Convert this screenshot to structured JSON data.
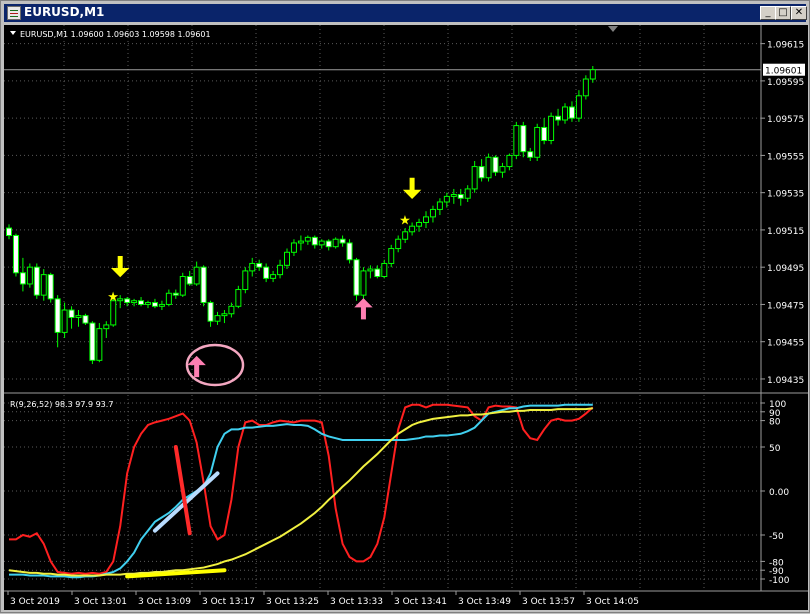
{
  "window": {
    "title": "EURUSD,M1",
    "minimize_label": "_",
    "restore_label": "□",
    "close_label": "✕"
  },
  "chart_data": [
    {
      "type": "candlestick",
      "title": "EURUSD,M1  1.09600 1.09603 1.09598 1.09601",
      "current_price_label": "1.09601",
      "current_price": 1.09601,
      "y_ticks": [
        1.09615,
        1.09595,
        1.09575,
        1.09555,
        1.09535,
        1.09515,
        1.09495,
        1.09475,
        1.09455,
        1.09435
      ],
      "y_tick_labels": [
        "1.09615",
        "1.09595",
        "1.09575",
        "1.09555",
        "1.09535",
        "1.09515",
        "1.09495",
        "1.09475",
        "1.09455",
        "1.09435"
      ],
      "ylim": [
        1.09428,
        1.09625
      ],
      "candle_up_color": "#00ff00",
      "candle_down_color": "#ffffff",
      "grid": true,
      "ohlc": [
        [
          1.09516,
          1.09518,
          1.0951,
          1.09512
        ],
        [
          1.09512,
          1.09513,
          1.0949,
          1.09492
        ],
        [
          1.09492,
          1.095,
          1.09482,
          1.09486
        ],
        [
          1.09486,
          1.09497,
          1.09484,
          1.09495
        ],
        [
          1.09495,
          1.09497,
          1.09478,
          1.0948
        ],
        [
          1.0948,
          1.09494,
          1.09477,
          1.09491
        ],
        [
          1.09491,
          1.09492,
          1.09476,
          1.09478
        ],
        [
          1.09478,
          1.0948,
          1.09452,
          1.0946
        ],
        [
          1.0946,
          1.09476,
          1.09457,
          1.09472
        ],
        [
          1.09472,
          1.09474,
          1.09462,
          1.09468
        ],
        [
          1.09468,
          1.09472,
          1.09463,
          1.09469
        ],
        [
          1.09469,
          1.0947,
          1.09464,
          1.09465
        ],
        [
          1.09465,
          1.09466,
          1.09443,
          1.09445
        ],
        [
          1.09445,
          1.09465,
          1.09444,
          1.09462
        ],
        [
          1.09462,
          1.09466,
          1.09457,
          1.09464
        ],
        [
          1.09464,
          1.09479,
          1.09463,
          1.09477
        ],
        [
          1.09477,
          1.0948,
          1.09473,
          1.09478
        ],
        [
          1.09478,
          1.09479,
          1.09474,
          1.09476
        ],
        [
          1.09476,
          1.09478,
          1.09474,
          1.09477
        ],
        [
          1.09477,
          1.09479,
          1.09474,
          1.09475
        ],
        [
          1.09475,
          1.09477,
          1.09473,
          1.09476
        ],
        [
          1.09476,
          1.09478,
          1.09473,
          1.09474
        ],
        [
          1.09474,
          1.09477,
          1.09472,
          1.09475
        ],
        [
          1.09475,
          1.09483,
          1.09474,
          1.09481
        ],
        [
          1.09481,
          1.09483,
          1.09478,
          1.0948
        ],
        [
          1.0948,
          1.09492,
          1.09479,
          1.0949
        ],
        [
          1.0949,
          1.09493,
          1.09485,
          1.09486
        ],
        [
          1.09486,
          1.09498,
          1.09485,
          1.09495
        ],
        [
          1.09495,
          1.09496,
          1.09474,
          1.09476
        ],
        [
          1.09476,
          1.09477,
          1.09463,
          1.09466
        ],
        [
          1.09466,
          1.09471,
          1.09464,
          1.09469
        ],
        [
          1.09469,
          1.09472,
          1.09465,
          1.0947
        ],
        [
          1.0947,
          1.09476,
          1.09468,
          1.09474
        ],
        [
          1.09474,
          1.09485,
          1.09473,
          1.09483
        ],
        [
          1.09483,
          1.09495,
          1.09481,
          1.09493
        ],
        [
          1.09493,
          1.095,
          1.0949,
          1.09497
        ],
        [
          1.09497,
          1.09499,
          1.09493,
          1.09495
        ],
        [
          1.09495,
          1.09497,
          1.09487,
          1.09489
        ],
        [
          1.09489,
          1.09493,
          1.09487,
          1.09491
        ],
        [
          1.09491,
          1.09499,
          1.09489,
          1.09496
        ],
        [
          1.09496,
          1.09505,
          1.09494,
          1.09503
        ],
        [
          1.09503,
          1.0951,
          1.09501,
          1.09508
        ],
        [
          1.09508,
          1.09512,
          1.09504,
          1.09509
        ],
        [
          1.09509,
          1.09512,
          1.09507,
          1.09511
        ],
        [
          1.09511,
          1.09512,
          1.09505,
          1.09507
        ],
        [
          1.09507,
          1.0951,
          1.09505,
          1.09509
        ],
        [
          1.09509,
          1.0951,
          1.09504,
          1.09506
        ],
        [
          1.09506,
          1.09511,
          1.09505,
          1.0951
        ],
        [
          1.0951,
          1.09512,
          1.09506,
          1.09508
        ],
        [
          1.09508,
          1.0951,
          1.09497,
          1.09499
        ],
        [
          1.09499,
          1.095,
          1.09477,
          1.0948
        ],
        [
          1.0948,
          1.09495,
          1.09478,
          1.09493
        ],
        [
          1.09493,
          1.09496,
          1.09489,
          1.09494
        ],
        [
          1.09494,
          1.09496,
          1.09489,
          1.0949
        ],
        [
          1.0949,
          1.09499,
          1.09489,
          1.09497
        ],
        [
          1.09497,
          1.09507,
          1.09495,
          1.09505
        ],
        [
          1.09505,
          1.09512,
          1.09503,
          1.0951
        ],
        [
          1.0951,
          1.09516,
          1.09508,
          1.09514
        ],
        [
          1.09514,
          1.09519,
          1.09512,
          1.09517
        ],
        [
          1.09517,
          1.09521,
          1.09514,
          1.09519
        ],
        [
          1.09519,
          1.09525,
          1.09516,
          1.09522
        ],
        [
          1.09522,
          1.09528,
          1.09519,
          1.09526
        ],
        [
          1.09526,
          1.09532,
          1.09523,
          1.0953
        ],
        [
          1.0953,
          1.09535,
          1.09527,
          1.09533
        ],
        [
          1.09533,
          1.09537,
          1.09529,
          1.09534
        ],
        [
          1.09534,
          1.09537,
          1.09528,
          1.09532
        ],
        [
          1.09532,
          1.09539,
          1.0953,
          1.09537
        ],
        [
          1.09537,
          1.09552,
          1.09535,
          1.09549
        ],
        [
          1.09549,
          1.09553,
          1.09541,
          1.09543
        ],
        [
          1.09543,
          1.09556,
          1.09541,
          1.09554
        ],
        [
          1.09554,
          1.09555,
          1.09544,
          1.09546
        ],
        [
          1.09546,
          1.09551,
          1.09543,
          1.09549
        ],
        [
          1.09549,
          1.09556,
          1.09547,
          1.09555
        ],
        [
          1.09555,
          1.09573,
          1.09553,
          1.09571
        ],
        [
          1.09571,
          1.09573,
          1.09554,
          1.09557
        ],
        [
          1.09557,
          1.09559,
          1.09552,
          1.09554
        ],
        [
          1.09554,
          1.09572,
          1.09552,
          1.0957
        ],
        [
          1.0957,
          1.09575,
          1.09561,
          1.09563
        ],
        [
          1.09563,
          1.09578,
          1.09561,
          1.09576
        ],
        [
          1.09576,
          1.0958,
          1.09571,
          1.09574
        ],
        [
          1.09574,
          1.09583,
          1.09572,
          1.09581
        ],
        [
          1.09581,
          1.09584,
          1.09573,
          1.09575
        ],
        [
          1.09575,
          1.0959,
          1.09573,
          1.09587
        ],
        [
          1.09587,
          1.09598,
          1.09585,
          1.09596
        ],
        [
          1.09596,
          1.09603,
          1.09594,
          1.09601
        ]
      ],
      "signals": [
        {
          "type": "sell-arrow",
          "bar": 16,
          "price": 1.0949
        },
        {
          "type": "star",
          "bar": 15,
          "price": 1.09479
        },
        {
          "type": "buy-arrow",
          "bar": 27,
          "price": 1.09447
        },
        {
          "type": "buy-arrow",
          "bar": 51,
          "price": 1.09478
        },
        {
          "type": "sell-arrow",
          "bar": 58,
          "price": 1.09532
        },
        {
          "type": "star",
          "bar": 57,
          "price": 1.0952
        }
      ]
    },
    {
      "type": "line",
      "title": "R(9,26,52) 98.3 97.9 93.7",
      "ylim": [
        -100,
        100
      ],
      "y_ticks": [
        100,
        90,
        80,
        50,
        0,
        -50,
        -80,
        -90,
        -100
      ],
      "y_tick_labels": [
        "100",
        "90",
        "80",
        "50",
        "0.00",
        "-50",
        "-80",
        "-90",
        "-100"
      ],
      "x_labels": [
        "3 Oct 2019",
        "3 Oct 13:01",
        "3 Oct 13:09",
        "3 Oct 13:17",
        "3 Oct 13:25",
        "3 Oct 13:33",
        "3 Oct 13:41",
        "3 Oct 13:49",
        "3 Oct 13:57",
        "3 Oct 14:05"
      ],
      "series": [
        {
          "color": "#ff2020",
          "values": [
            -55,
            -55,
            -50,
            -52,
            -48,
            -60,
            -80,
            -92,
            -93,
            -94,
            -93,
            -94,
            -93,
            -94,
            -92,
            -80,
            -40,
            20,
            50,
            65,
            75,
            78,
            80,
            82,
            85,
            88,
            80,
            55,
            10,
            -40,
            -55,
            -50,
            -10,
            50,
            78,
            80,
            75,
            75,
            78,
            80,
            79,
            78,
            80,
            80,
            80,
            78,
            40,
            -20,
            -60,
            -75,
            -80,
            -80,
            -75,
            -60,
            -30,
            20,
            70,
            95,
            98,
            98,
            95,
            98,
            98,
            98,
            97,
            96,
            95,
            85,
            80,
            95,
            97,
            96,
            96,
            95,
            70,
            60,
            58,
            70,
            80,
            82,
            80,
            80,
            82,
            88,
            95
          ]
        },
        {
          "color": "#40d0f0",
          "values": [
            -95,
            -95,
            -95,
            -96,
            -96,
            -96,
            -97,
            -97,
            -97,
            -98,
            -98,
            -97,
            -97,
            -96,
            -94,
            -92,
            -88,
            -80,
            -70,
            -55,
            -45,
            -35,
            -30,
            -25,
            -18,
            -10,
            -5,
            0,
            5,
            20,
            50,
            65,
            70,
            70,
            72,
            72,
            73,
            74,
            74,
            75,
            76,
            75,
            75,
            74,
            70,
            65,
            62,
            60,
            58,
            58,
            58,
            58,
            58,
            58,
            58,
            58,
            58,
            58,
            59,
            60,
            62,
            62,
            63,
            63,
            64,
            65,
            68,
            72,
            80,
            88,
            90,
            92,
            94,
            94,
            96,
            97,
            97,
            97,
            97,
            97,
            98,
            98,
            98,
            98,
            98
          ]
        },
        {
          "color": "#f0f040",
          "values": [
            -90,
            -91,
            -92,
            -93,
            -93,
            -94,
            -94,
            -95,
            -95,
            -96,
            -96,
            -96,
            -96,
            -96,
            -95,
            -95,
            -95,
            -94,
            -94,
            -93,
            -93,
            -92,
            -92,
            -91,
            -90,
            -90,
            -89,
            -88,
            -87,
            -85,
            -83,
            -80,
            -78,
            -75,
            -72,
            -68,
            -64,
            -60,
            -56,
            -52,
            -47,
            -42,
            -37,
            -31,
            -25,
            -18,
            -10,
            -3,
            5,
            12,
            20,
            28,
            35,
            42,
            50,
            58,
            65,
            70,
            75,
            78,
            80,
            82,
            83,
            84,
            85,
            86,
            86,
            87,
            87,
            88,
            89,
            90,
            90,
            91,
            91,
            92,
            92,
            92,
            92,
            93,
            93,
            93,
            93,
            93,
            94
          ]
        }
      ],
      "annotations": [
        {
          "type": "line",
          "color": "#b8dcff",
          "from": [
            21,
            -45
          ],
          "to": [
            30,
            20
          ]
        },
        {
          "type": "line",
          "color": "#ff2a2a",
          "from": [
            24,
            50
          ],
          "to": [
            26,
            -48
          ]
        },
        {
          "type": "line",
          "color": "#ffff00",
          "from": [
            17,
            -97
          ],
          "to": [
            31,
            -90
          ]
        }
      ]
    }
  ]
}
